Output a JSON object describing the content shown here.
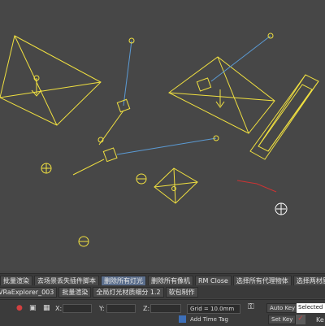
{
  "viewport": {
    "bg_color": "#474747",
    "light_color": "#f0e040",
    "link_color": "#5b9bd5",
    "selected_color": "#ffffff",
    "axis_color": "#cc3333"
  },
  "scripts_toolbar": {
    "row1": [
      {
        "label": "批量渲染"
      },
      {
        "label": "去场景丢失插件脚本"
      },
      {
        "label": "删除所有灯光"
      },
      {
        "label": "删除所有像机"
      },
      {
        "label": "RM Close"
      },
      {
        "label": "选择所有代理物体"
      },
      {
        "label": "选择两材质物体"
      }
    ],
    "row2": [
      {
        "label": "VRaExplorer_003"
      },
      {
        "label": "批量渲染"
      },
      {
        "label": "全局灯光材质细分 1.2"
      },
      {
        "label": "软包制作"
      }
    ]
  },
  "statusbar": {
    "x_label": "X:",
    "y_label": "Y:",
    "z_label": "Z:",
    "grid_label": "Grid = 10.0mm",
    "auto_key_label": "Auto Key",
    "selected_value": "Selected",
    "set_key_label": "Set Key",
    "key_filters_label": "Ke",
    "add_time_tag_label": "Add Time Tag",
    "icons": [
      "pin-icon",
      "lock-icon",
      "absolute-mode-icon",
      "key-icon",
      "curve-icon",
      "time-tag-icon"
    ]
  }
}
